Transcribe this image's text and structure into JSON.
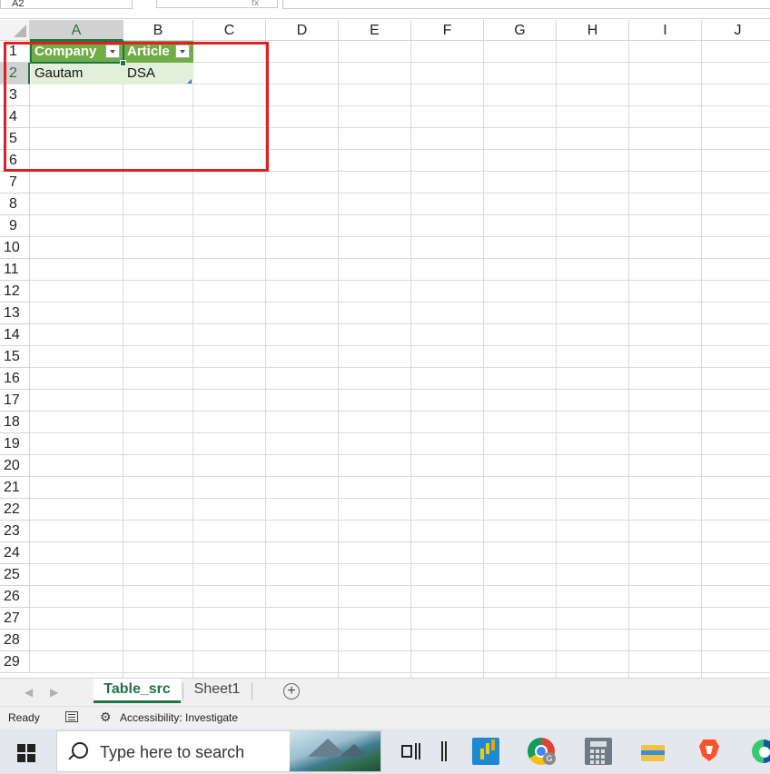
{
  "formula_bar": {
    "name_box": "A2",
    "fx_label": "fx"
  },
  "columns": [
    "A",
    "B",
    "C",
    "D",
    "E",
    "F",
    "G",
    "H",
    "I",
    "J"
  ],
  "rows": [
    "1",
    "2",
    "3",
    "4",
    "5",
    "6",
    "7",
    "8",
    "9",
    "10",
    "11",
    "12",
    "13",
    "14",
    "15",
    "16",
    "17",
    "18",
    "19",
    "20",
    "21",
    "22",
    "23",
    "24",
    "25",
    "26",
    "27",
    "28",
    "29"
  ],
  "table": {
    "headers": [
      "Company",
      "Article"
    ],
    "rows": [
      [
        "Gautam",
        "DSA"
      ]
    ]
  },
  "sheets": {
    "tabs": [
      "Table_src",
      "Sheet1"
    ],
    "active": "Table_src",
    "add_label": "+"
  },
  "status": {
    "ready": "Ready",
    "accessibility": "Accessibility: Investigate"
  },
  "taskbar": {
    "search_placeholder": "Type here to search",
    "chrome_badge": "G"
  },
  "colors": {
    "table_header": "#70ad47",
    "table_row": "#e2efda",
    "excel_green": "#217346",
    "highlight_red": "#e02020"
  }
}
